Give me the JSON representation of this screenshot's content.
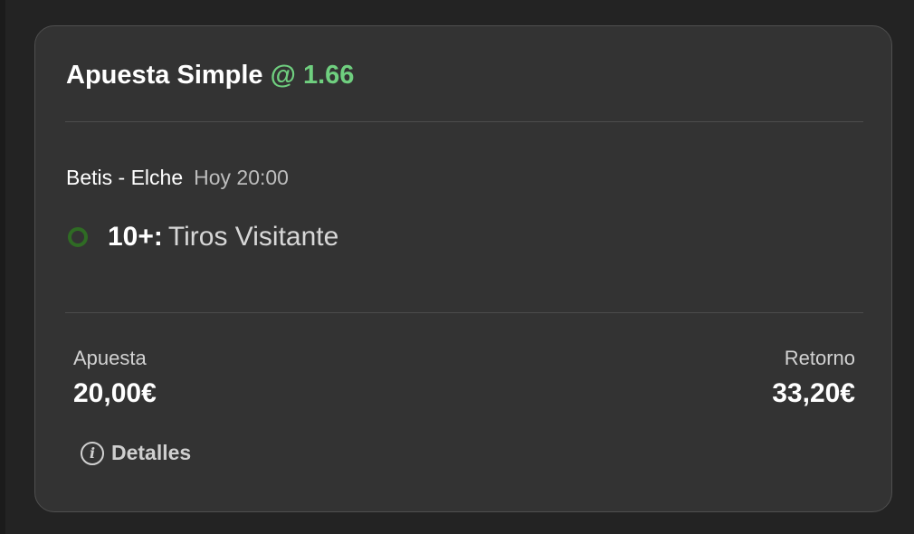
{
  "bet": {
    "title": "Apuesta Simple",
    "odds": "@ 1.66"
  },
  "event": {
    "teams": "Betis - Elche",
    "time": "Hoy 20:00"
  },
  "selection": {
    "value": "10+:",
    "market": "Tiros Visitante"
  },
  "stake": {
    "label": "Apuesta",
    "amount": "20,00€"
  },
  "returns": {
    "label": "Retorno",
    "amount": "33,20€"
  },
  "details": {
    "label": "Detalles",
    "icon": "info-icon"
  },
  "colors": {
    "odds": "#6fcf7f",
    "selection_indicator": "#2f6b24",
    "card_background": "#333333"
  }
}
